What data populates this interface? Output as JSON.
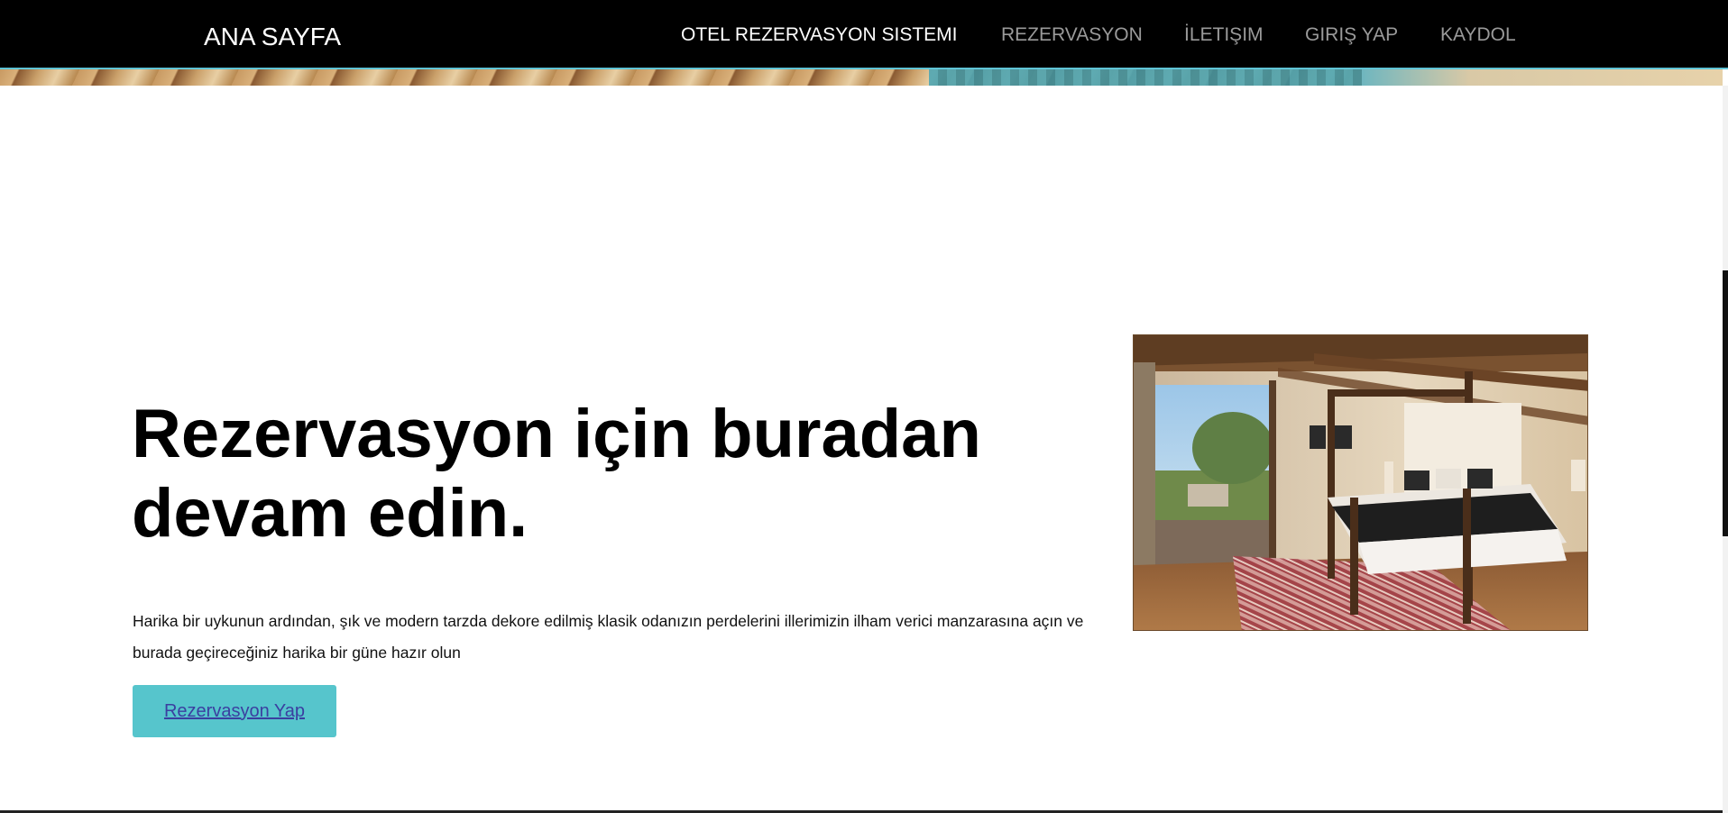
{
  "navbar": {
    "brand": "ANA SAYFA",
    "links": [
      {
        "label": "OTEL REZERVASYON SISTEMI",
        "active": true
      },
      {
        "label": "REZERVASYON",
        "active": false
      },
      {
        "label": "İLETIŞIM",
        "active": false
      },
      {
        "label": "GIRIŞ YAP",
        "active": false
      },
      {
        "label": "KAYDOL",
        "active": false
      }
    ]
  },
  "main": {
    "headline": "Rezervasyon için buradan devam edin.",
    "description": "Harika bir uykunun ardından, şık ve modern tarzda dekore edilmiş klasik odanızın perdelerini illerimizin ilham verici manzarasına açın ve burada geçireceğiniz harika bir güne hazır olun",
    "cta_label": "Rezervasyon Yap"
  },
  "colors": {
    "navbar_bg": "#000000",
    "accent": "#56c5cc",
    "link_inactive": "#9a9a9a",
    "link_active": "#ffffff"
  }
}
